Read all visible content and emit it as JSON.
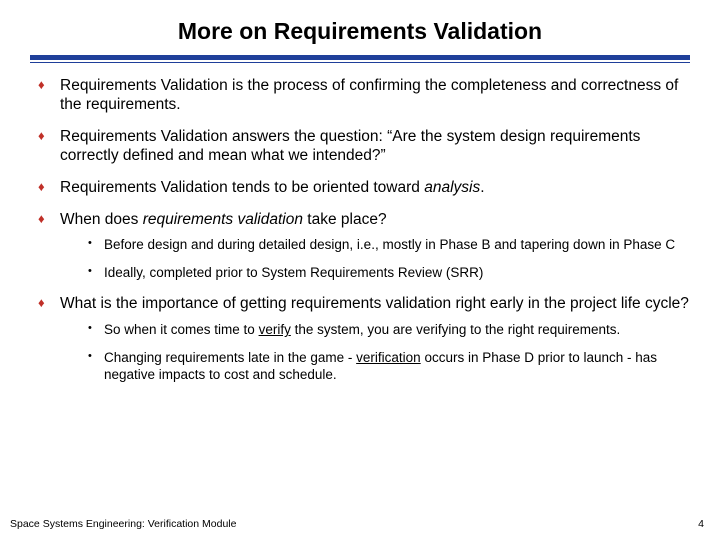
{
  "title": "More on Requirements Validation",
  "b1": {
    "r1": "Requirements Validation",
    "r2": " is the process of confirming the completeness and correctness of the requirements."
  },
  "b2": {
    "r1": "Requirements Validation",
    "r2": " answers the question: “Are the system design requirements correctly defined and mean what we intended?”"
  },
  "b3": {
    "r1": "Requirements Validation",
    "r2": " tends to be oriented toward ",
    "r3": "analysis",
    "r4": "."
  },
  "b4": {
    "r1": "When does ",
    "r2": "requirements validation",
    "r3": " take place?",
    "s1": "Before design and during detailed design, i.e., mostly in Phase B and tapering down in Phase C",
    "s2": "Ideally, completed prior to System Requirements Review (SRR)"
  },
  "b5": {
    "r1": "What is the importance of getting requirements validation right early in the project life cycle?",
    "s1a": "So when it comes time to ",
    "s1b": "verify",
    "s1c": " the system, you are verifying to the right requirements.",
    "s2a": "Changing requirements late in the game - ",
    "s2b": "verification",
    "s2c": " occurs in Phase D prior to launch - has negative impacts to cost and schedule."
  },
  "footer": {
    "left": "Space Systems Engineering: Verification Module",
    "right": "4"
  }
}
